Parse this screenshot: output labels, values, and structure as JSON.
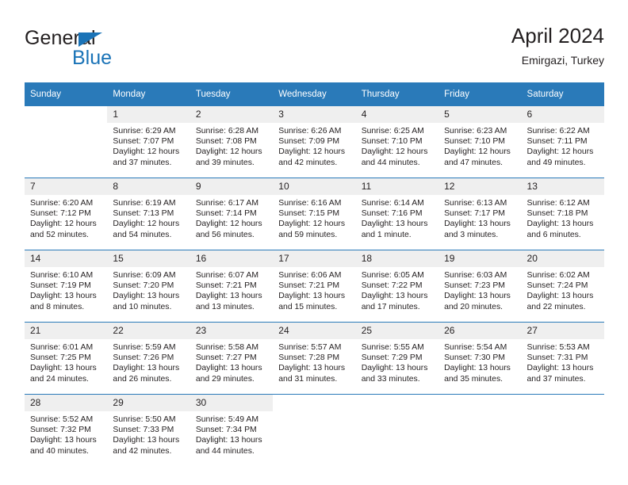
{
  "brand": {
    "name_part1": "General",
    "name_part2": "Blue",
    "triangle_icon": "triangle-icon",
    "accent_color": "#1a73b7"
  },
  "header": {
    "title": "April 2024",
    "subtitle": "Emirgazi, Turkey"
  },
  "theme": {
    "header_bg": "#2a7ab9",
    "header_text": "#ffffff",
    "daynum_bg": "#efefef",
    "cell_bg": "#ffffff",
    "rule_color": "#2a7ab9",
    "text_color": "#231f20"
  },
  "weekday_headers": [
    "Sunday",
    "Monday",
    "Tuesday",
    "Wednesday",
    "Thursday",
    "Friday",
    "Saturday"
  ],
  "weeks": [
    [
      {
        "day": "",
        "blank": true,
        "sunrise": "",
        "sunset": "",
        "daylight_line1": "",
        "daylight_line2": ""
      },
      {
        "day": "1",
        "sunrise": "Sunrise: 6:29 AM",
        "sunset": "Sunset: 7:07 PM",
        "daylight_line1": "Daylight: 12 hours",
        "daylight_line2": "and 37 minutes."
      },
      {
        "day": "2",
        "sunrise": "Sunrise: 6:28 AM",
        "sunset": "Sunset: 7:08 PM",
        "daylight_line1": "Daylight: 12 hours",
        "daylight_line2": "and 39 minutes."
      },
      {
        "day": "3",
        "sunrise": "Sunrise: 6:26 AM",
        "sunset": "Sunset: 7:09 PM",
        "daylight_line1": "Daylight: 12 hours",
        "daylight_line2": "and 42 minutes."
      },
      {
        "day": "4",
        "sunrise": "Sunrise: 6:25 AM",
        "sunset": "Sunset: 7:10 PM",
        "daylight_line1": "Daylight: 12 hours",
        "daylight_line2": "and 44 minutes."
      },
      {
        "day": "5",
        "sunrise": "Sunrise: 6:23 AM",
        "sunset": "Sunset: 7:10 PM",
        "daylight_line1": "Daylight: 12 hours",
        "daylight_line2": "and 47 minutes."
      },
      {
        "day": "6",
        "sunrise": "Sunrise: 6:22 AM",
        "sunset": "Sunset: 7:11 PM",
        "daylight_line1": "Daylight: 12 hours",
        "daylight_line2": "and 49 minutes."
      }
    ],
    [
      {
        "day": "7",
        "sunrise": "Sunrise: 6:20 AM",
        "sunset": "Sunset: 7:12 PM",
        "daylight_line1": "Daylight: 12 hours",
        "daylight_line2": "and 52 minutes."
      },
      {
        "day": "8",
        "sunrise": "Sunrise: 6:19 AM",
        "sunset": "Sunset: 7:13 PM",
        "daylight_line1": "Daylight: 12 hours",
        "daylight_line2": "and 54 minutes."
      },
      {
        "day": "9",
        "sunrise": "Sunrise: 6:17 AM",
        "sunset": "Sunset: 7:14 PM",
        "daylight_line1": "Daylight: 12 hours",
        "daylight_line2": "and 56 minutes."
      },
      {
        "day": "10",
        "sunrise": "Sunrise: 6:16 AM",
        "sunset": "Sunset: 7:15 PM",
        "daylight_line1": "Daylight: 12 hours",
        "daylight_line2": "and 59 minutes."
      },
      {
        "day": "11",
        "sunrise": "Sunrise: 6:14 AM",
        "sunset": "Sunset: 7:16 PM",
        "daylight_line1": "Daylight: 13 hours",
        "daylight_line2": "and 1 minute."
      },
      {
        "day": "12",
        "sunrise": "Sunrise: 6:13 AM",
        "sunset": "Sunset: 7:17 PM",
        "daylight_line1": "Daylight: 13 hours",
        "daylight_line2": "and 3 minutes."
      },
      {
        "day": "13",
        "sunrise": "Sunrise: 6:12 AM",
        "sunset": "Sunset: 7:18 PM",
        "daylight_line1": "Daylight: 13 hours",
        "daylight_line2": "and 6 minutes."
      }
    ],
    [
      {
        "day": "14",
        "sunrise": "Sunrise: 6:10 AM",
        "sunset": "Sunset: 7:19 PM",
        "daylight_line1": "Daylight: 13 hours",
        "daylight_line2": "and 8 minutes."
      },
      {
        "day": "15",
        "sunrise": "Sunrise: 6:09 AM",
        "sunset": "Sunset: 7:20 PM",
        "daylight_line1": "Daylight: 13 hours",
        "daylight_line2": "and 10 minutes."
      },
      {
        "day": "16",
        "sunrise": "Sunrise: 6:07 AM",
        "sunset": "Sunset: 7:21 PM",
        "daylight_line1": "Daylight: 13 hours",
        "daylight_line2": "and 13 minutes."
      },
      {
        "day": "17",
        "sunrise": "Sunrise: 6:06 AM",
        "sunset": "Sunset: 7:21 PM",
        "daylight_line1": "Daylight: 13 hours",
        "daylight_line2": "and 15 minutes."
      },
      {
        "day": "18",
        "sunrise": "Sunrise: 6:05 AM",
        "sunset": "Sunset: 7:22 PM",
        "daylight_line1": "Daylight: 13 hours",
        "daylight_line2": "and 17 minutes."
      },
      {
        "day": "19",
        "sunrise": "Sunrise: 6:03 AM",
        "sunset": "Sunset: 7:23 PM",
        "daylight_line1": "Daylight: 13 hours",
        "daylight_line2": "and 20 minutes."
      },
      {
        "day": "20",
        "sunrise": "Sunrise: 6:02 AM",
        "sunset": "Sunset: 7:24 PM",
        "daylight_line1": "Daylight: 13 hours",
        "daylight_line2": "and 22 minutes."
      }
    ],
    [
      {
        "day": "21",
        "sunrise": "Sunrise: 6:01 AM",
        "sunset": "Sunset: 7:25 PM",
        "daylight_line1": "Daylight: 13 hours",
        "daylight_line2": "and 24 minutes."
      },
      {
        "day": "22",
        "sunrise": "Sunrise: 5:59 AM",
        "sunset": "Sunset: 7:26 PM",
        "daylight_line1": "Daylight: 13 hours",
        "daylight_line2": "and 26 minutes."
      },
      {
        "day": "23",
        "sunrise": "Sunrise: 5:58 AM",
        "sunset": "Sunset: 7:27 PM",
        "daylight_line1": "Daylight: 13 hours",
        "daylight_line2": "and 29 minutes."
      },
      {
        "day": "24",
        "sunrise": "Sunrise: 5:57 AM",
        "sunset": "Sunset: 7:28 PM",
        "daylight_line1": "Daylight: 13 hours",
        "daylight_line2": "and 31 minutes."
      },
      {
        "day": "25",
        "sunrise": "Sunrise: 5:55 AM",
        "sunset": "Sunset: 7:29 PM",
        "daylight_line1": "Daylight: 13 hours",
        "daylight_line2": "and 33 minutes."
      },
      {
        "day": "26",
        "sunrise": "Sunrise: 5:54 AM",
        "sunset": "Sunset: 7:30 PM",
        "daylight_line1": "Daylight: 13 hours",
        "daylight_line2": "and 35 minutes."
      },
      {
        "day": "27",
        "sunrise": "Sunrise: 5:53 AM",
        "sunset": "Sunset: 7:31 PM",
        "daylight_line1": "Daylight: 13 hours",
        "daylight_line2": "and 37 minutes."
      }
    ],
    [
      {
        "day": "28",
        "sunrise": "Sunrise: 5:52 AM",
        "sunset": "Sunset: 7:32 PM",
        "daylight_line1": "Daylight: 13 hours",
        "daylight_line2": "and 40 minutes."
      },
      {
        "day": "29",
        "sunrise": "Sunrise: 5:50 AM",
        "sunset": "Sunset: 7:33 PM",
        "daylight_line1": "Daylight: 13 hours",
        "daylight_line2": "and 42 minutes."
      },
      {
        "day": "30",
        "sunrise": "Sunrise: 5:49 AM",
        "sunset": "Sunset: 7:34 PM",
        "daylight_line1": "Daylight: 13 hours",
        "daylight_line2": "and 44 minutes."
      },
      {
        "day": "",
        "blank": true,
        "sunrise": "",
        "sunset": "",
        "daylight_line1": "",
        "daylight_line2": ""
      },
      {
        "day": "",
        "blank": true,
        "sunrise": "",
        "sunset": "",
        "daylight_line1": "",
        "daylight_line2": ""
      },
      {
        "day": "",
        "blank": true,
        "sunrise": "",
        "sunset": "",
        "daylight_line1": "",
        "daylight_line2": ""
      },
      {
        "day": "",
        "blank": true,
        "sunrise": "",
        "sunset": "",
        "daylight_line1": "",
        "daylight_line2": ""
      }
    ]
  ]
}
